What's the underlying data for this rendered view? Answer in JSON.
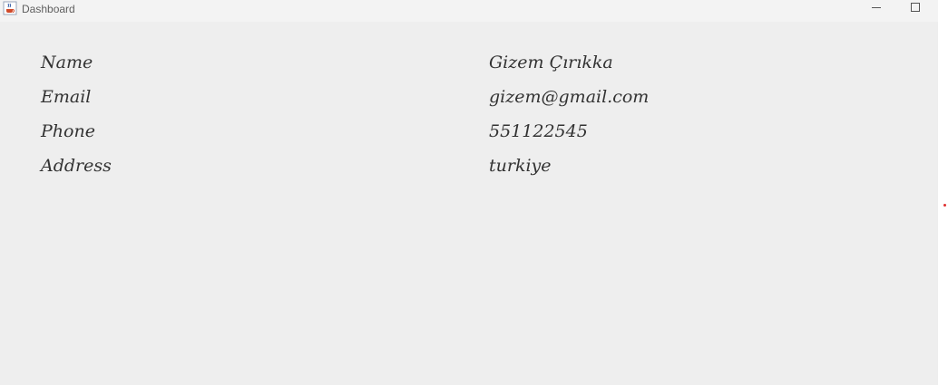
{
  "window": {
    "title": "Dashboard",
    "icon": "java-cup-icon"
  },
  "fields": [
    {
      "label": "Name",
      "value": "Gizem Çırıkka"
    },
    {
      "label": "Email",
      "value": "gizem@gmail.com"
    },
    {
      "label": "Phone",
      "value": "551122545"
    },
    {
      "label": "Address",
      "value": "turkiye"
    }
  ],
  "colors": {
    "background": "#eeeeee",
    "titlebar": "#f3f3f3",
    "text": "#333333",
    "accent_dot": "#e03030"
  }
}
